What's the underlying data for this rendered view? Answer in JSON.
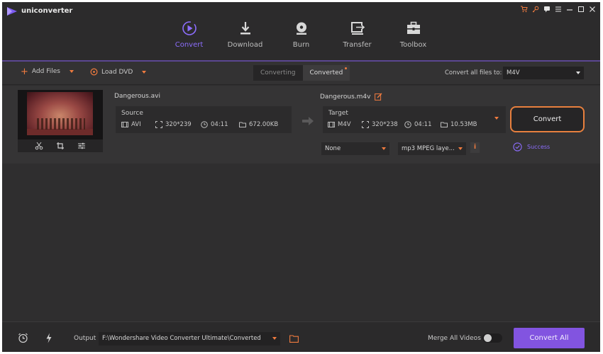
{
  "app": {
    "name": "uniconverter"
  },
  "nav": [
    {
      "label": "Convert",
      "icon": "convert-icon",
      "active": true
    },
    {
      "label": "Download",
      "icon": "download-icon"
    },
    {
      "label": "Burn",
      "icon": "burn-icon"
    },
    {
      "label": "Transfer",
      "icon": "transfer-icon"
    },
    {
      "label": "Toolbox",
      "icon": "toolbox-icon"
    }
  ],
  "toolbar": {
    "add_files": "Add Files",
    "load_dvd": "Load DVD",
    "tabs": [
      "Converting",
      "Converted"
    ],
    "convert_all_label": "Convert all files to:",
    "format": "M4V"
  },
  "item": {
    "source_name": "Dangerous.avi",
    "source_label": "Source",
    "source": {
      "format": "AVI",
      "resolution": "320*239",
      "duration": "04:11",
      "size": "672.00KB"
    },
    "target_name": "Dangerous.m4v",
    "target_label": "Target",
    "target": {
      "format": "M4V",
      "resolution": "320*238",
      "duration": "04:11",
      "size": "10.53MB"
    },
    "subtitle": "None",
    "audio": "mp3 MPEG laye...",
    "convert_button": "Convert",
    "status": "Success"
  },
  "footer": {
    "output_label": "Output",
    "output_path": "F:\\Wondershare Video Converter Ultimate\\Converted",
    "merge_label": "Merge All Videos",
    "merge_on": false,
    "convert_all": "Convert All"
  },
  "colors": {
    "accent": "#8c6dfc",
    "orange": "#f07b3f",
    "button": "#8254e0",
    "background": "#2f2e2f"
  }
}
